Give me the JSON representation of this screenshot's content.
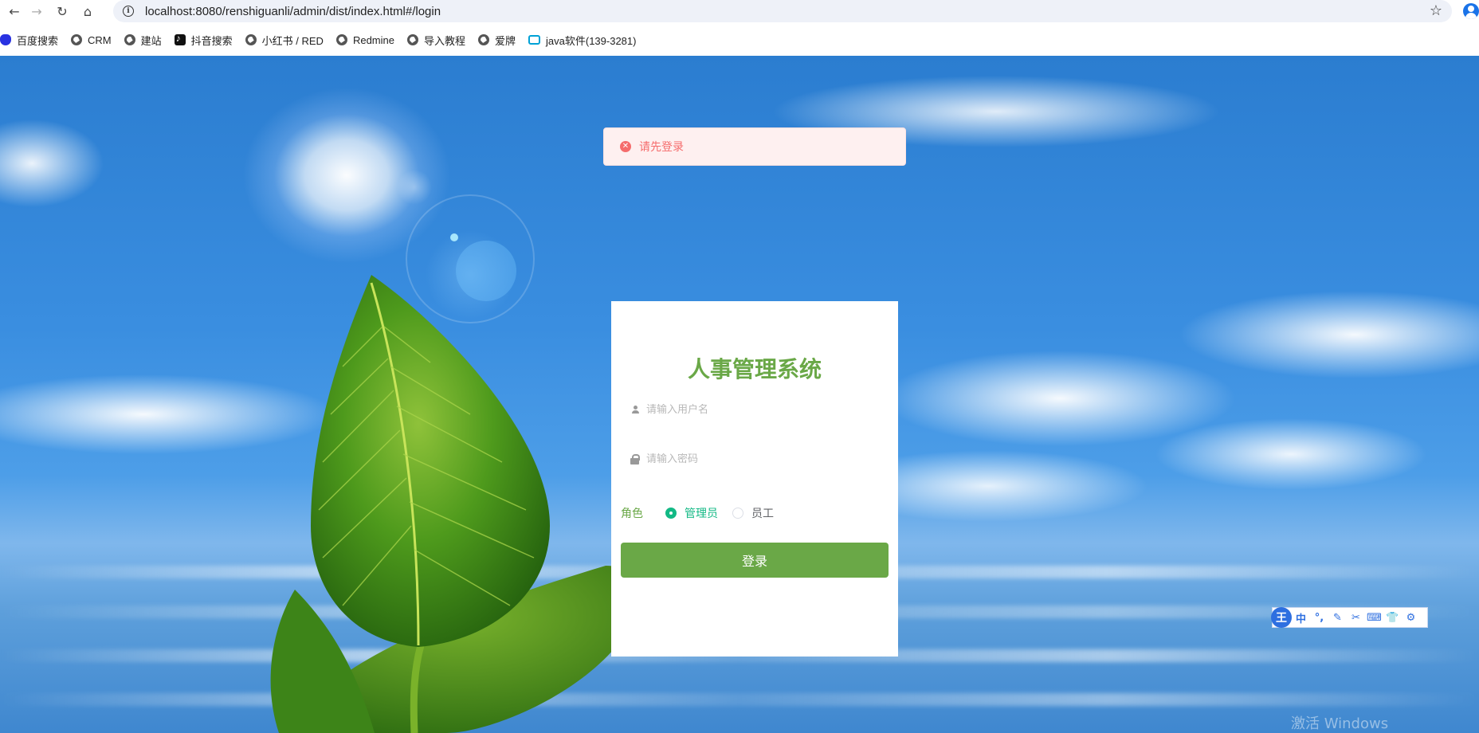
{
  "browser": {
    "url": "localhost:8080/renshiguanli/admin/dist/index.html#/login",
    "bookmarks": [
      {
        "label": "百度搜索",
        "icon": "baidu-icon"
      },
      {
        "label": "CRM",
        "icon": "globe-icon"
      },
      {
        "label": "建站",
        "icon": "globe-icon"
      },
      {
        "label": "抖音搜索",
        "icon": "tiktok-icon"
      },
      {
        "label": "小红书 / RED",
        "icon": "globe-icon"
      },
      {
        "label": "Redmine",
        "icon": "globe-icon"
      },
      {
        "label": "导入教程",
        "icon": "globe-icon"
      },
      {
        "label": "爱牌",
        "icon": "globe-icon"
      },
      {
        "label": "java软件(139-3281)",
        "icon": "bilibili-icon"
      }
    ]
  },
  "toast": {
    "type": "error",
    "message": "请先登录"
  },
  "login": {
    "title": "人事管理系统",
    "username_placeholder": "请输入用户名",
    "password_placeholder": "请输入密码",
    "role_label": "角色",
    "roles": [
      {
        "label": "管理员",
        "checked": true
      },
      {
        "label": "员工",
        "checked": false
      }
    ],
    "submit_label": "登录"
  },
  "ime": {
    "logo": "王",
    "items": [
      "中",
      "°,",
      "✎",
      "✂",
      "⌨",
      "👕",
      "⚙"
    ]
  },
  "watermark": "激活 Windows",
  "colors": {
    "accent_green": "#6aa847",
    "radio_checked": "#13b985",
    "error_text": "#f56c6c",
    "error_bg": "#fef0f0"
  }
}
